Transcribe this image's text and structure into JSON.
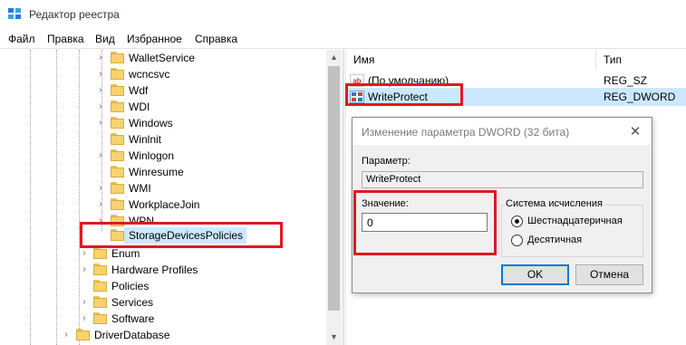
{
  "window": {
    "title": "Редактор реестра",
    "icon": "registry-editor-icon"
  },
  "menu": [
    "Файл",
    "Правка",
    "Вид",
    "Избранное",
    "Справка"
  ],
  "tree": {
    "items": [
      {
        "label": "WalletService"
      },
      {
        "label": "wcncsvc"
      },
      {
        "label": "Wdf"
      },
      {
        "label": "WDI"
      },
      {
        "label": "Windows"
      },
      {
        "label": "Winlnit"
      },
      {
        "label": "Winlogon"
      },
      {
        "label": "Winresume"
      },
      {
        "label": "WMI"
      },
      {
        "label": "WorkplaceJoin"
      },
      {
        "label": "WPN"
      },
      {
        "label": "StorageDevicesPolicies",
        "selected": true
      },
      {
        "label": "Enum"
      },
      {
        "label": "Hardware Profiles"
      },
      {
        "label": "Policies"
      },
      {
        "label": "Services"
      },
      {
        "label": "Software"
      },
      {
        "label": "DriverDatabase"
      }
    ]
  },
  "list": {
    "headers": {
      "name": "Имя",
      "type": "Тип"
    },
    "rows": [
      {
        "icon": "string-value-icon",
        "icon_text": "ab",
        "name": "(По умолчанию)",
        "type": "REG_SZ"
      },
      {
        "icon": "binary-value-icon",
        "name": "WriteProtect",
        "type": "REG_DWORD"
      }
    ]
  },
  "dialog": {
    "title": "Изменение параметра DWORD (32 бита)",
    "param_label": "Параметр:",
    "param_value": "WriteProtect",
    "value_label": "Значение:",
    "value": "0",
    "base_group_title": "Система исчисления",
    "radio_hex": "Шестнадцатеричная",
    "radio_dec": "Десятичная",
    "selected_base": "hex",
    "ok": "OK",
    "cancel": "Отмена"
  },
  "colors": {
    "highlight": "#e0191e",
    "selection": "#cce8ff",
    "folder": "#f7d26f",
    "accent": "#0078d7"
  }
}
